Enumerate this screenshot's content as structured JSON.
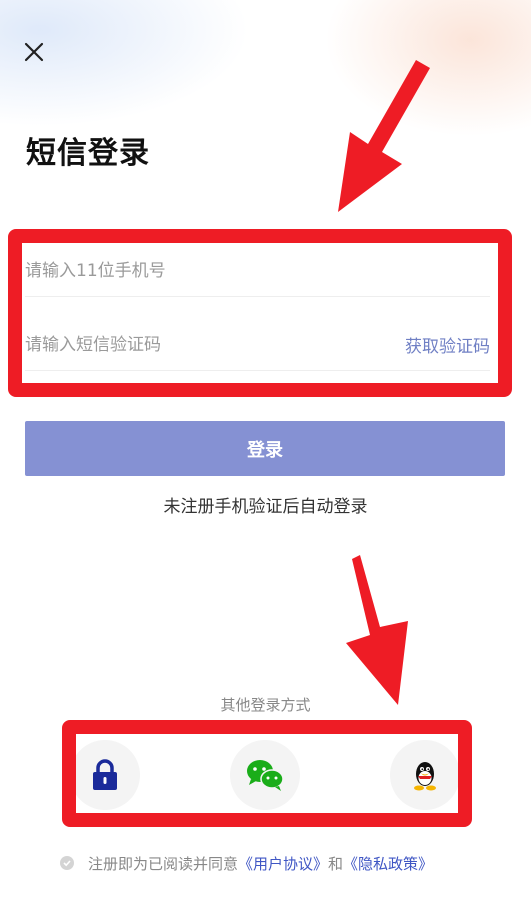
{
  "header": {
    "close_icon": "close-icon",
    "title": "短信登录"
  },
  "form": {
    "phone_placeholder": "请输入11位手机号",
    "code_placeholder": "请输入短信验证码",
    "get_code_label": "获取验证码",
    "login_label": "登录",
    "hint": "未注册手机验证后自动登录"
  },
  "other_login": {
    "title": "其他登录方式",
    "methods": [
      {
        "icon": "lock-icon"
      },
      {
        "icon": "wechat-icon"
      },
      {
        "icon": "qq-icon"
      }
    ]
  },
  "agreement": {
    "prefix": "注册即为已阅读并同意",
    "user_agreement": "《用户协议》",
    "and": "和",
    "privacy_policy": "《隐私政策》"
  },
  "colors": {
    "login_button": "#8591d3",
    "link": "#3f56c4",
    "annotation": "#ee1c25"
  }
}
